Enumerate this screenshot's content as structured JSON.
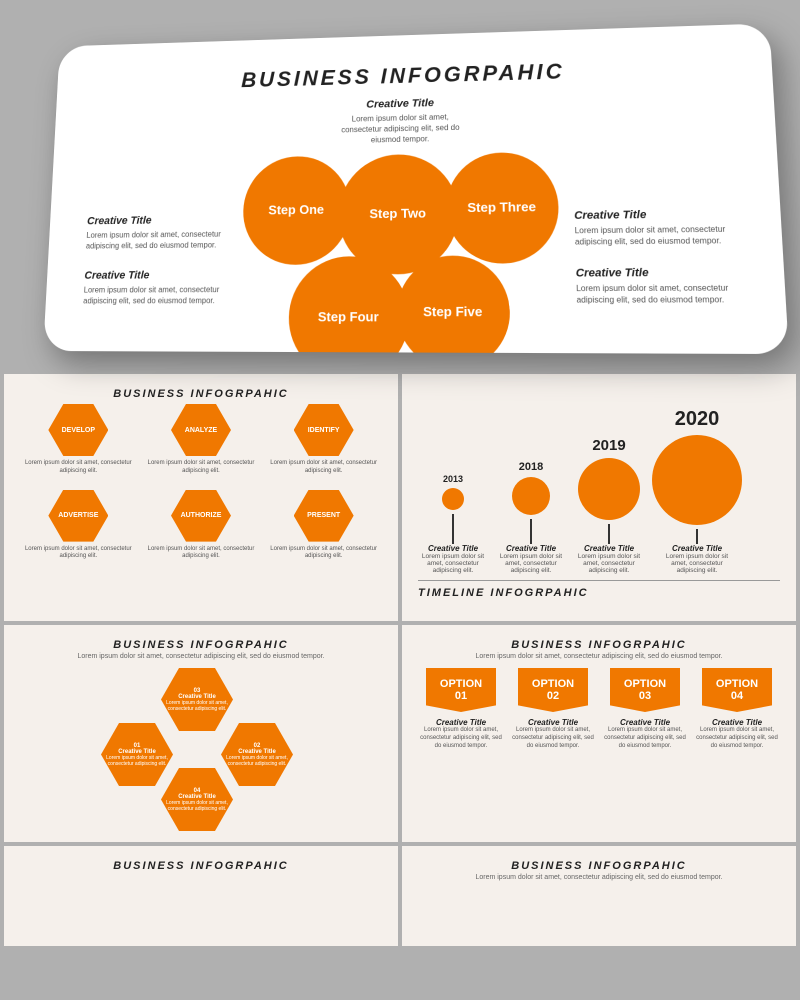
{
  "hero": {
    "title": "BUSINESS INFOGRPAHIC",
    "steps": [
      {
        "label": "Step One"
      },
      {
        "label": "Step Two"
      },
      {
        "label": "Step Three"
      },
      {
        "label": "Step Four"
      },
      {
        "label": "Step Five"
      }
    ],
    "left_blocks": [
      {
        "title": "Creative Title",
        "desc": "Lorem ipsum dolor sit amet, consectetur adipiscing elit, sed do eiusmod tempor."
      },
      {
        "title": "Creative Title",
        "desc": "Lorem ipsum dolor sit amet, consectetur adipiscing elit, sed do eiusmod tempor."
      }
    ],
    "right_blocks": [
      {
        "title": "Creative Title",
        "desc": "Lorem ipsum dolor sit amet, consectetur adipiscing elit, sed do eiusmod tempor."
      },
      {
        "title": "Creative Title",
        "desc": "Lorem ipsum dolor sit amet, consectetur adipiscing elit, sed do eiusmod tempor."
      }
    ],
    "top_block": {
      "title": "Creative Title",
      "desc": "Lorem ipsum dolor sit amet, consectetur adipiscing elit, sed do eiusmod tempor."
    }
  },
  "hex_section": {
    "title": "BUSINESS INFOGRPAHIC",
    "items": [
      {
        "label": "DEVELOP",
        "desc": "Lorem ipsum dolor sit amet, consectetur adipiscing elit."
      },
      {
        "label": "ANALYZE",
        "desc": "Lorem ipsum dolor sit amet, consectetur adipiscing elit."
      },
      {
        "label": "IDENTIFY",
        "desc": "Lorem ipsum dolor sit amet, consectetur adipiscing elit."
      },
      {
        "label": "ADVERTISE",
        "desc": "Lorem ipsum dolor sit amet, consectetur adipiscing elit."
      },
      {
        "label": "AUTHORIZE",
        "desc": "Lorem ipsum dolor sit amet, consectetur adipiscing elit."
      },
      {
        "label": "PRESENT",
        "desc": "Lorem ipsum dolor sit amet, consectetur adipiscing elit."
      }
    ]
  },
  "timeline_section": {
    "title": "TIMELINE INFOGRPAHIC",
    "years": [
      "2013",
      "2018",
      "2019",
      "2020"
    ],
    "items": [
      {
        "year": "2013",
        "size": 20,
        "title": "Creative Title",
        "desc": "Lorem ipsum dolor sit amet, consectetur adipiscing elit."
      },
      {
        "year": "2018",
        "size": 35,
        "title": "Creative Title",
        "desc": "Lorem ipsum dolor sit amet, consectetur adipiscing elit."
      },
      {
        "year": "2019",
        "size": 60,
        "title": "Creative Title",
        "desc": "Lorem ipsum dolor sit amet, consectetur adipiscing elit."
      },
      {
        "year": "2020",
        "size": 90,
        "title": "Creative Title",
        "desc": "Lorem ipsum dolor sit amet, consectetur adipiscing elit."
      }
    ]
  },
  "honeycomb_section": {
    "title": "BUSINESS INFOGRPAHIC",
    "subtitle": "Lorem ipsum dolor sit amet, consectetur adipiscing elit, sed do eiusmod tempor.",
    "items": [
      {
        "number": "01",
        "title": "Creative Title",
        "desc": "Lorem ipsum dolor sit amet, consectetur adipiscing elit."
      },
      {
        "number": "02",
        "title": "Creative Title",
        "desc": "Lorem ipsum dolor sit amet, consectetur adipiscing elit."
      },
      {
        "number": "03",
        "title": "Creative Title",
        "desc": "Lorem ipsum dolor sit amet, consectetur adipiscing elit."
      },
      {
        "number": "04",
        "title": "Creative Title",
        "desc": "Lorem ipsum dolor sit amet, consectetur adipiscing elit."
      }
    ]
  },
  "options_section": {
    "title": "BUSINESS INFOGRPAHIC",
    "subtitle": "Lorem ipsum dolor sit amet, consectetur adipiscing elit, sed do eiusmod tempor.",
    "options": [
      {
        "label": "OPTION\n01",
        "title": "Creative Title",
        "desc": "Lorem ipsum dolor sit amet, consectetur adipiscing elit, sed do eiusmod tempor."
      },
      {
        "label": "OPTION\n02",
        "title": "Creative Title",
        "desc": "Lorem ipsum dolor sit amet, consectetur adipiscing elit, sed do eiusmod tempor."
      },
      {
        "label": "OPTION\n03",
        "title": "Creative Title",
        "desc": "Lorem ipsum dolor sit amet, consectetur adipiscing elit, sed do eiusmod tempor."
      },
      {
        "label": "OPTION\n04",
        "title": "Creative Title",
        "desc": "Lorem ipsum dolor sit amet, consectetur adipiscing elit, sed do eiusmod tempor."
      }
    ]
  },
  "bottom_left": {
    "title": "BUSINESS INFOGRPAHIC"
  },
  "bottom_right": {
    "title": "BUSINESS INFOGRPAHIC",
    "subtitle": "Lorem ipsum dolor sit amet, consectetur adipiscing elit, sed do eiusmod tempor."
  },
  "accent_color": "#f07800"
}
